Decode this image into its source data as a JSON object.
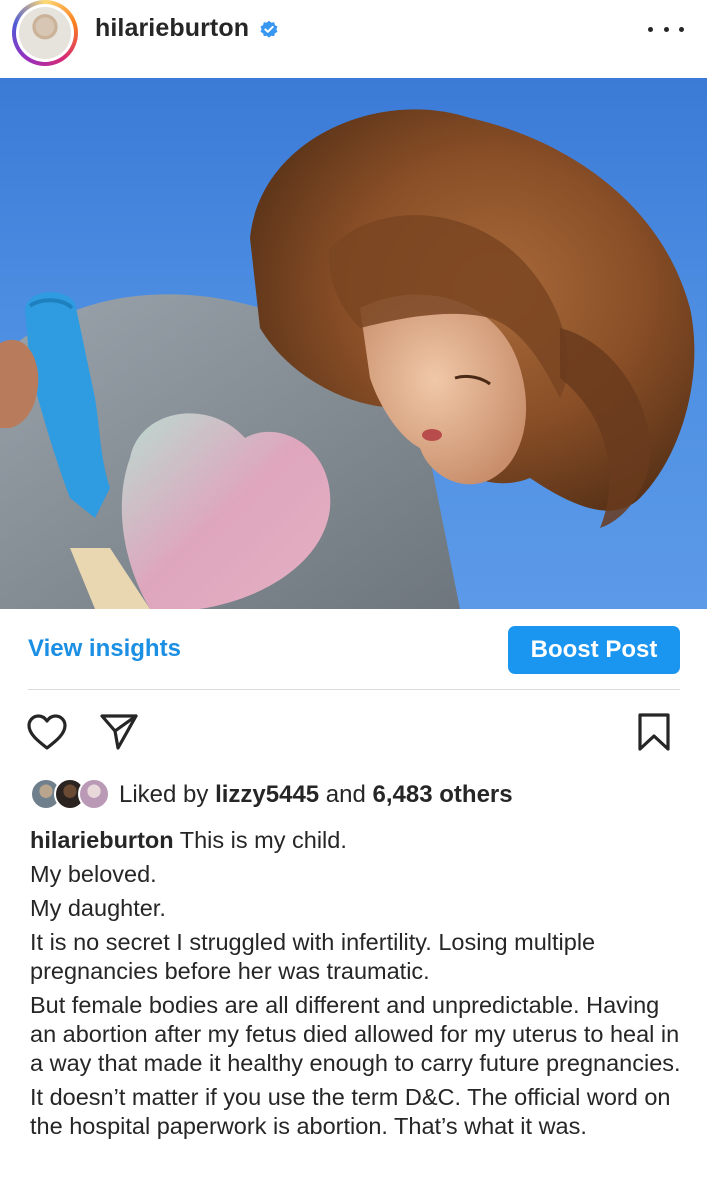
{
  "header": {
    "username": "hilarieburton",
    "verified": true,
    "more_icon": "more-horizontal-icon"
  },
  "post": {
    "image_alt": "Child with curly hair against blue sky"
  },
  "insights": {
    "view_insights_label": "View insights",
    "boost_label": "Boost Post"
  },
  "actions": {
    "like_icon": "heart-icon",
    "share_icon": "send-icon",
    "save_icon": "bookmark-icon"
  },
  "likes": {
    "prefix": "Liked by ",
    "liker": "lizzy5445",
    "middle": " and ",
    "others": "6,483 others"
  },
  "caption": {
    "username": "hilarieburton",
    "lines": [
      " This is my child.",
      "My beloved.",
      "My daughter.",
      "It is no secret I struggled with infertility. Losing multiple pregnancies before her was traumatic.",
      "But female bodies are all different and unpredictable. Having an abortion after my fetus died allowed for my uterus to heal in a way that made it healthy enough to carry future pregnancies.",
      "It doesn’t matter if you use the term D&C. The official word on the hospital paperwork is abortion. That’s what it was."
    ]
  },
  "colors": {
    "accent": "#1a95f0",
    "link": "#1a8fe3",
    "verified": "#3897f0"
  }
}
